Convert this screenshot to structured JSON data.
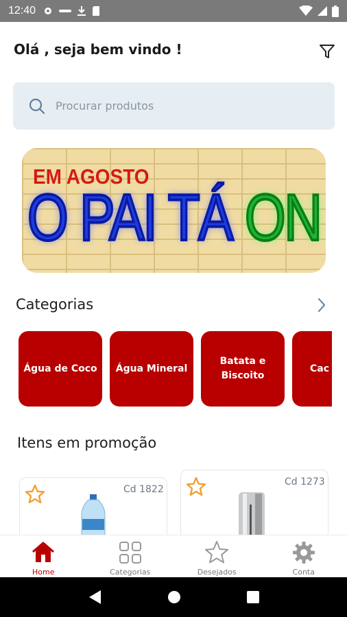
{
  "status_bar": {
    "time": "12:40"
  },
  "header": {
    "greeting": "Olá , seja bem vindo !"
  },
  "search": {
    "placeholder": "Procurar produtos"
  },
  "banner": {
    "line1": "EM AGOSTO",
    "word1": "O PAI TÁ",
    "word2": "ON"
  },
  "categories": {
    "title": "Categorias",
    "items": [
      {
        "label": "Água de Coco"
      },
      {
        "label": "Água Mineral"
      },
      {
        "label": "Batata e Biscoito"
      },
      {
        "label": "Cac"
      }
    ]
  },
  "promotions": {
    "title": "Itens em promoção",
    "items": [
      {
        "code": "Cd 1822"
      },
      {
        "code": "Cd 1273"
      }
    ]
  },
  "bottom_nav": {
    "items": [
      {
        "label": "Home",
        "icon": "home-icon",
        "active": true
      },
      {
        "label": "Categorias",
        "icon": "grid-icon",
        "active": false
      },
      {
        "label": "Desejados",
        "icon": "star-icon",
        "active": false
      },
      {
        "label": "Conta",
        "icon": "gear-icon",
        "active": false
      }
    ]
  },
  "colors": {
    "accent": "#b80000",
    "star": "#f0a030",
    "search_bg": "#e6eef3"
  }
}
